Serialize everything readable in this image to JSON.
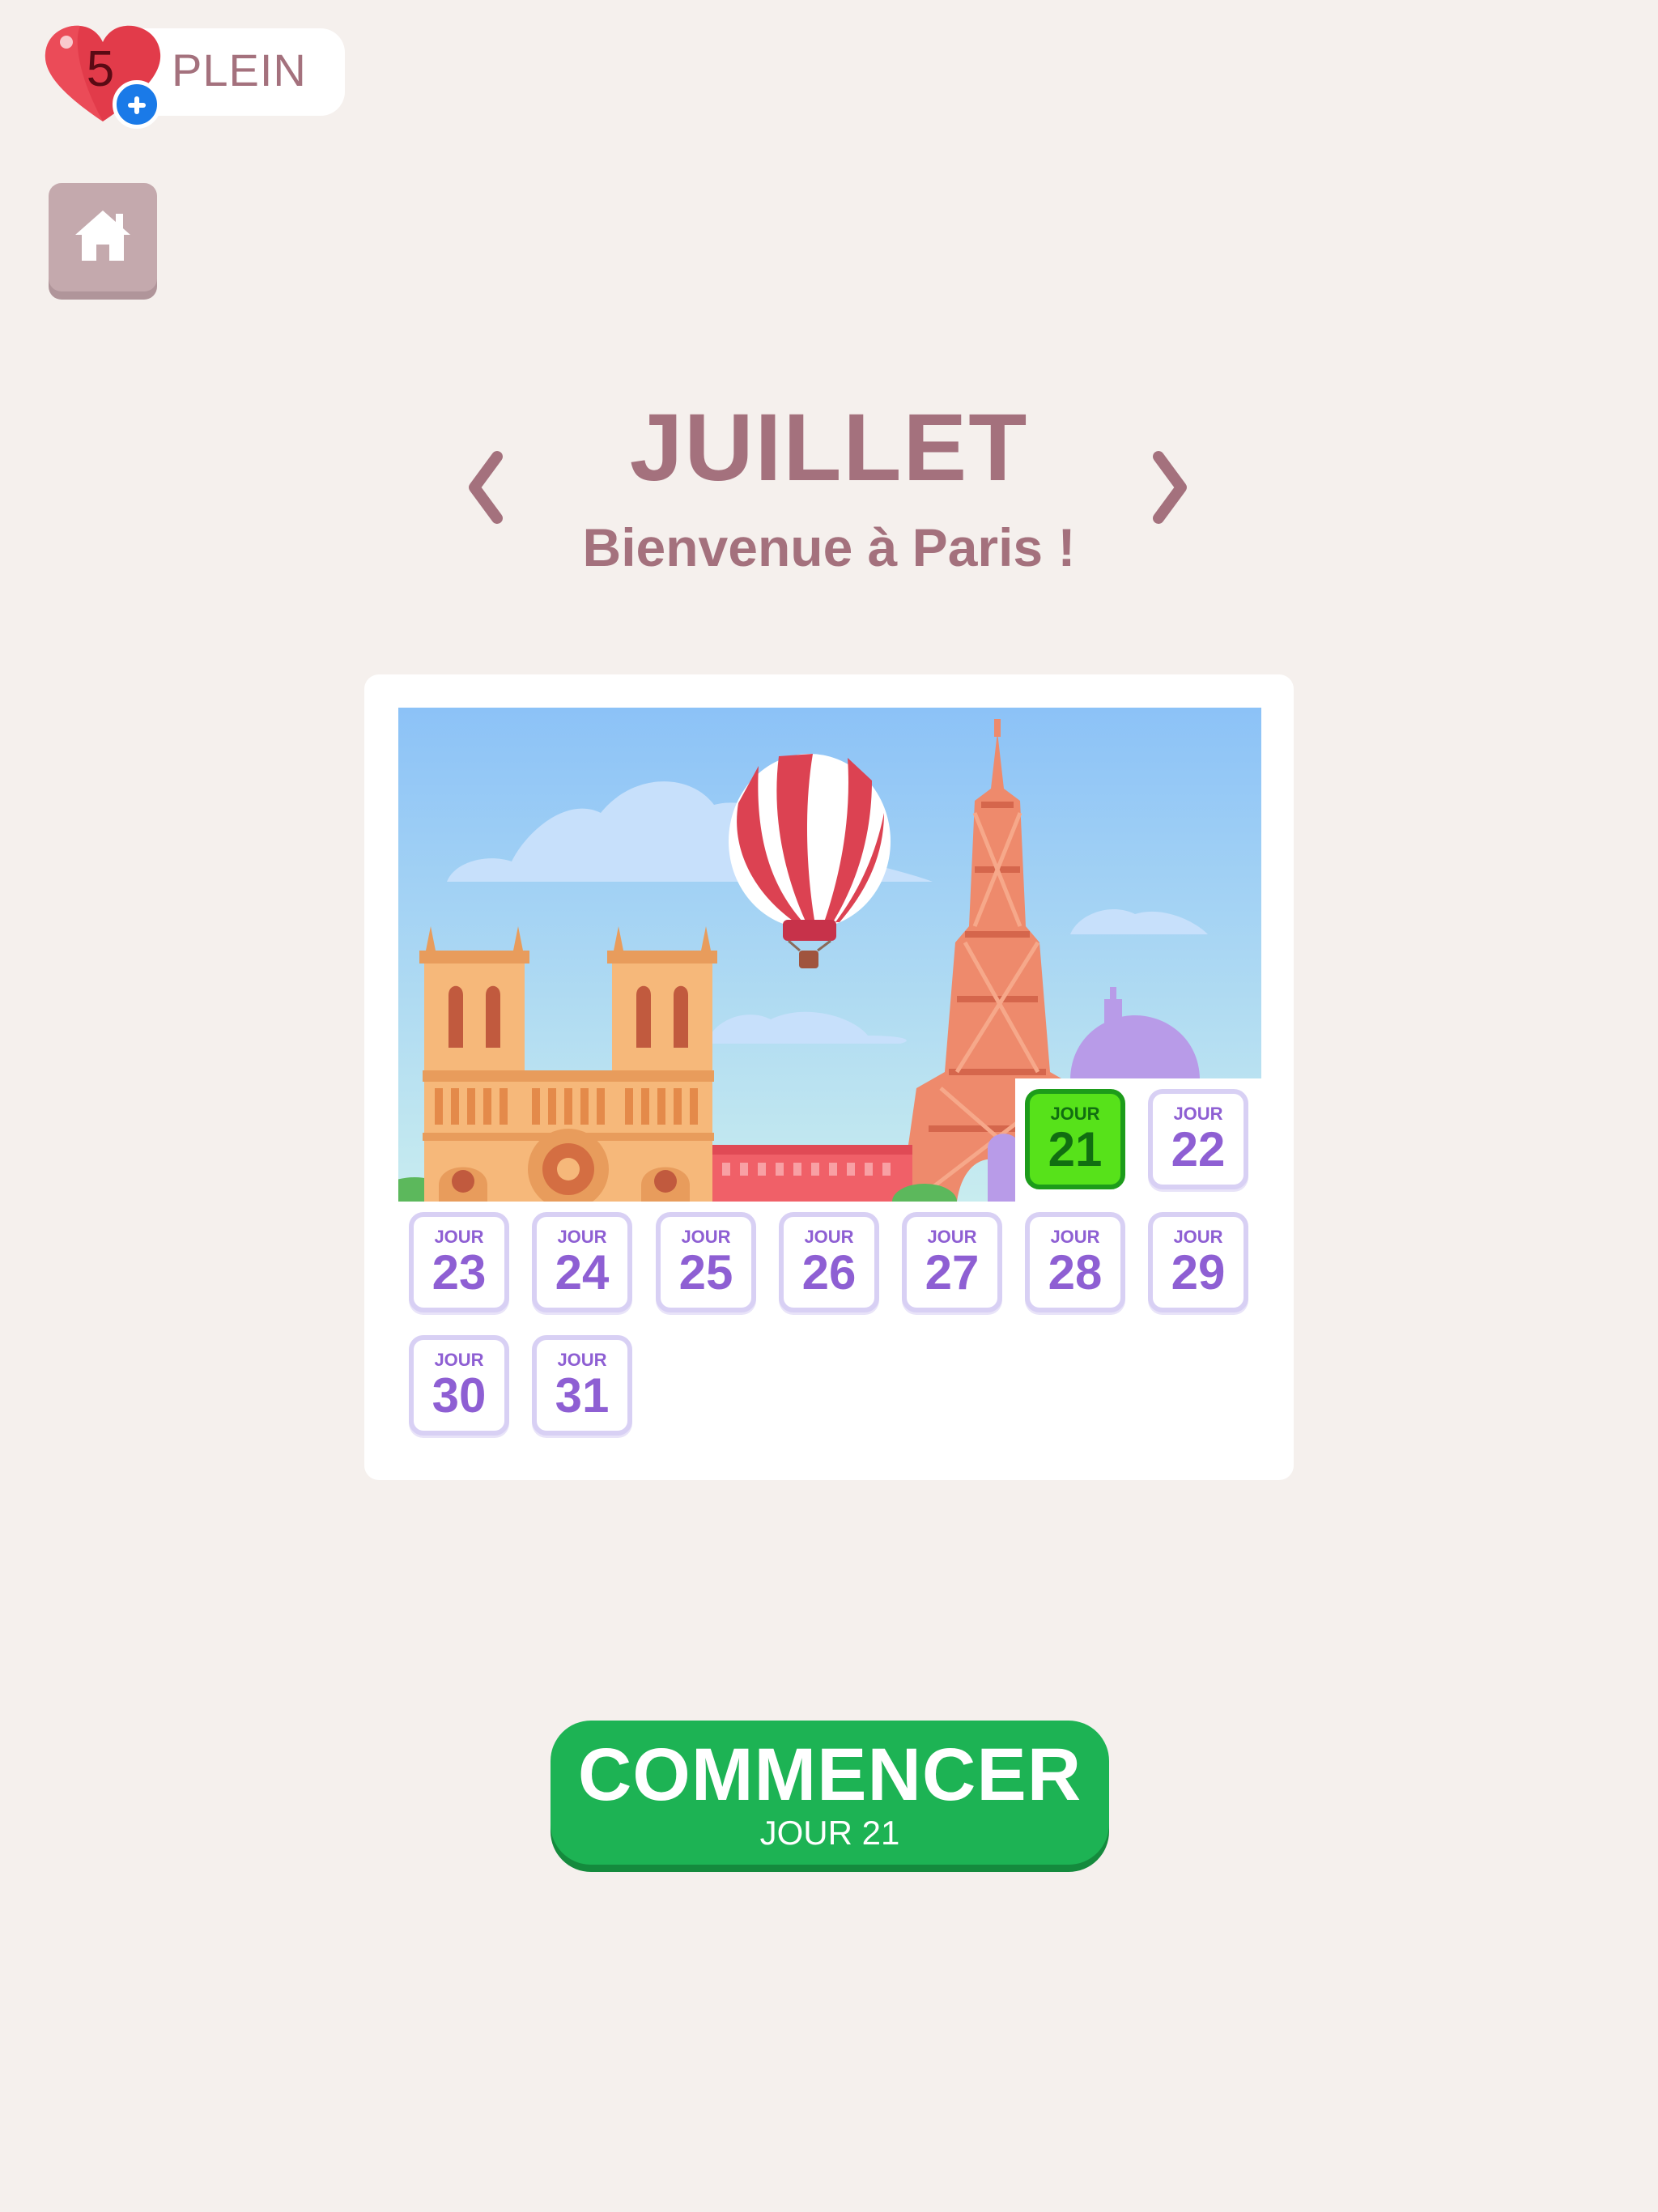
{
  "lives": {
    "count": "5",
    "status": "PLEIN"
  },
  "month": {
    "title": "JUILLET",
    "subtitle": "Bienvenue à Paris !"
  },
  "calendar": {
    "day_word": "JOUR",
    "current_day": "21",
    "days": [
      "21",
      "22",
      "23",
      "24",
      "25",
      "26",
      "27",
      "28",
      "29",
      "30",
      "31"
    ]
  },
  "cta": {
    "title": "COMMENCER",
    "subtitle": "JOUR 21"
  },
  "colors": {
    "background": "#f5f0ed",
    "title": "#a4717d",
    "tile_text": "#8e5fd3",
    "tile_border": "#d8d0f4",
    "current_tile": "#57e21a",
    "cta": "#1db354"
  },
  "icons": [
    "heart-icon",
    "plus-icon",
    "home-icon",
    "chevron-left-icon",
    "chevron-right-icon"
  ]
}
